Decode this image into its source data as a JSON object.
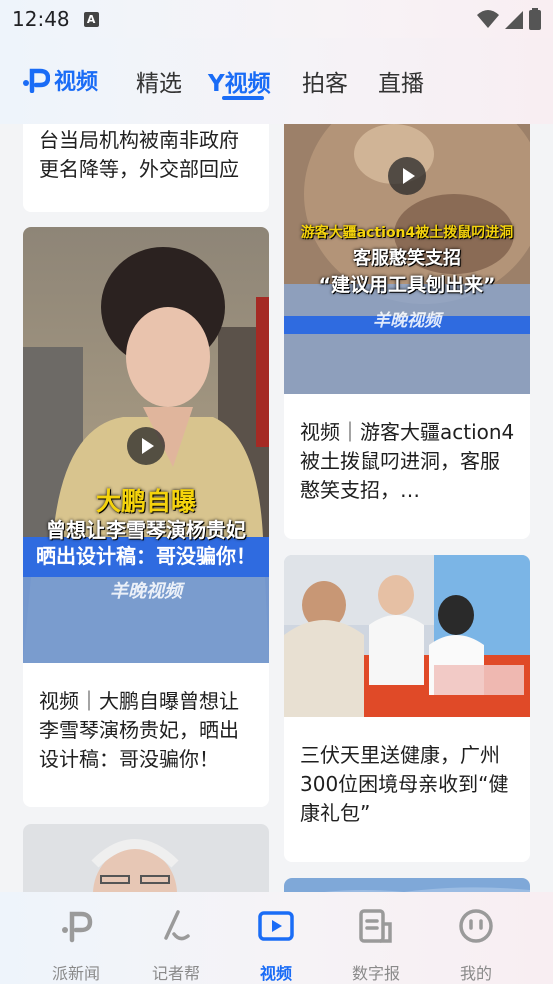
{
  "status_bar": {
    "time": "12:48",
    "notification_glyph": "A",
    "icons": [
      "wifi-icon",
      "signal-icon",
      "battery-icon"
    ]
  },
  "top_nav": {
    "logo_text": "视频",
    "tabs": [
      {
        "label": "精选",
        "active": false
      },
      {
        "label": "Y视频",
        "active": true
      },
      {
        "label": "拍客",
        "active": false
      },
      {
        "label": "直播",
        "active": false
      }
    ]
  },
  "feed": {
    "left_column": [
      {
        "title": "台当局机构被南非政府更名降等，外交部回应"
      },
      {
        "title": "视频｜大鹏自曝曾想让李雪琴演杨贵妃，晒出设计稿：哥没骗你！",
        "caption_line1": "大鹏自曝",
        "caption_line2": "曾想让李雪琴演杨贵妃",
        "caption_line3": "晒出设计稿：哥没骗你！",
        "watermark": "羊晚视频"
      },
      {
        "title": ""
      }
    ],
    "right_column": [
      {
        "title": "视频｜游客大疆action4被土拨鼠叼进洞，客服憨笑支招，…",
        "caption_line1": "游客大疆action4被土拨鼠叼进洞",
        "caption_line2": "客服憨笑支招",
        "caption_line3": "“建议用工具刨出来”",
        "watermark": "羊晚视频"
      },
      {
        "title": "三伏天里送健康，广州300位困境母亲收到“健康礼包”"
      },
      {
        "title": ""
      }
    ]
  },
  "bottom_nav": {
    "items": [
      {
        "label": "派新闻",
        "icon": "pai-logo-icon",
        "active": false
      },
      {
        "label": "记者帮",
        "icon": "reporter-icon",
        "active": false
      },
      {
        "label": "视频",
        "icon": "video-icon",
        "active": true
      },
      {
        "label": "数字报",
        "icon": "newspaper-icon",
        "active": false
      },
      {
        "label": "我的",
        "icon": "profile-icon",
        "active": false
      }
    ]
  },
  "colors": {
    "accent": "#1a6cf6",
    "caption_yellow": "#f5d30c",
    "caption_band_blue": "#2f6be0",
    "inactive_label": "#8a8a8a"
  }
}
